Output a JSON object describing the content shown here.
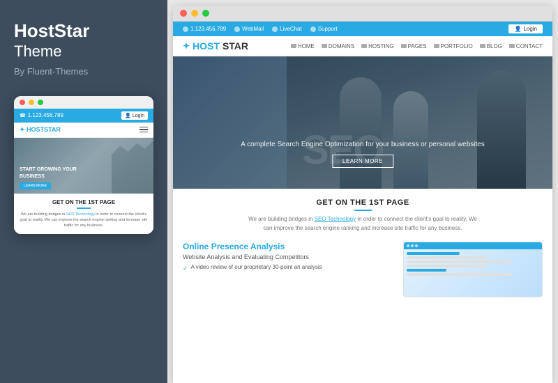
{
  "leftPanel": {
    "brandTitle": "HostStar",
    "brandSubtitle": "Theme",
    "byLine": "By Fluent-Themes"
  },
  "mobilePreview": {
    "topInfo": {
      "phone": "1.123.456.789",
      "loginLabel": "Login"
    },
    "nav": {
      "logoMain": "HOST",
      "logoEnd": "STAR"
    },
    "hero": {
      "text": "START GROWING YOUR",
      "text2": "BUSINESS"
    },
    "content": {
      "title": "GET ON THE 1ST PAGE",
      "desc": "We are building bridges in SEO Technology in order to connect the client's goal to reality. We can improve the search engine ranking and increase site traffic for any business.",
      "linkText": "SEO Technology"
    }
  },
  "browserPreview": {
    "topBar": {
      "phone": "1.123.456.789",
      "webmail": "WebMail",
      "livechat": "LiveChat",
      "support": "Support",
      "loginLabel": "Login"
    },
    "nav": {
      "logoMain": "HOST",
      "logoEnd": "STAR",
      "links": [
        "HOME",
        "DOMAINS",
        "HOSTING",
        "PAGES",
        "PORTFOLIO",
        "BLOG",
        "CONTACT"
      ]
    },
    "hero": {
      "bigText": "SEO",
      "subtitle": "A complete Search Engine Optimization for your business or personal websites",
      "ctaLabel": "LEARN MORE"
    },
    "content": {
      "title": "GET ON THE 1ST PAGE",
      "desc": "We are building bridges in SEO Technology in order to connect the client's goal to reality. We can improve the search engine ranking and increase site traffic for any business.",
      "linkText": "SEO Technology",
      "analysisTitle": "Online",
      "analysisTitleBlue": "Presence Analysis",
      "analysisSub": "Website Analysis and Evaluating Competitors",
      "checkItem": "A video review of our proprietary 30-point an analysis"
    }
  },
  "colors": {
    "accent": "#29aae3",
    "dark": "#3d4d5e",
    "text": "#333333",
    "muted": "#777777"
  }
}
